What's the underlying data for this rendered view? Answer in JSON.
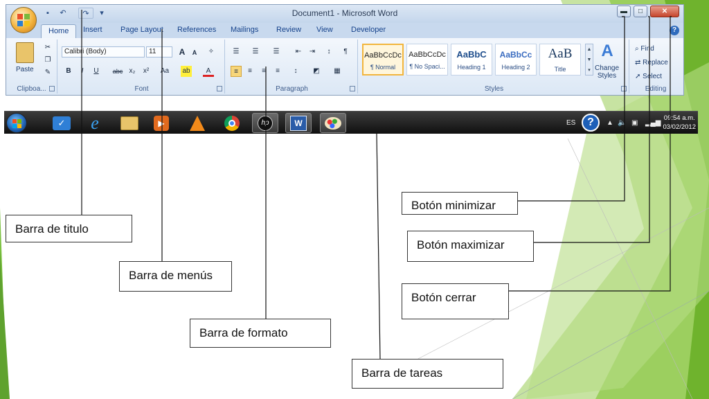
{
  "word": {
    "window_title": "Document1 - Microsoft Word",
    "tabs": [
      "Home",
      "Insert",
      "Page Layout",
      "References",
      "Mailings",
      "Review",
      "View",
      "Developer"
    ],
    "clipboard": {
      "paste_label": "Paste",
      "group_label": "Clipboa..."
    },
    "font": {
      "name": "Calibri (Body)",
      "size": "11",
      "group_label": "Font",
      "bold": "B",
      "italic": "I",
      "underline": "U",
      "strike": "abc",
      "subscript": "x₂",
      "superscript": "x²",
      "change_case": "Aa",
      "grow": "A",
      "shrink": "A"
    },
    "paragraph": {
      "group_label": "Paragraph",
      "show_marks": "¶"
    },
    "styles": {
      "group_label": "Styles",
      "cards": [
        {
          "preview": "AaBbCcDc",
          "name": "¶ Normal"
        },
        {
          "preview": "AaBbCcDc",
          "name": "¶ No Spaci..."
        },
        {
          "preview": "AaBbC",
          "name": "Heading 1"
        },
        {
          "preview": "AaBbCc",
          "name": "Heading 2"
        },
        {
          "preview": "AaB",
          "name": "Title"
        }
      ],
      "change_styles_line1": "Change",
      "change_styles_line2": "Styles"
    },
    "editing": {
      "find": "Find",
      "replace": "Replace",
      "select": "Select",
      "group_label": "Editing"
    }
  },
  "taskbar": {
    "language": "ES",
    "time": "09:54 a.m.",
    "date": "03/02/2012",
    "icons": [
      "start-orb-icon",
      "tasks-icon",
      "internet-explorer-icon",
      "file-explorer-icon",
      "media-player-icon",
      "vlc-icon",
      "chrome-icon",
      "hp-icon",
      "word-icon",
      "paint-icon"
    ]
  },
  "labels": {
    "title_bar": "Barra de titulo",
    "menu_bar": "Barra de menús",
    "format_bar": "Barra de formato",
    "taskbar": "Barra de tareas",
    "minimize": "Botón minimizar",
    "maximize": "Botón maximizar",
    "close": "Botón cerrar"
  },
  "colors": {
    "ribbon_blue": "#dfe9f5",
    "tab_text": "#15428b",
    "accent_green": "#7dc242",
    "close_red": "#c6452c",
    "taskbar": "#1a1a1a"
  }
}
